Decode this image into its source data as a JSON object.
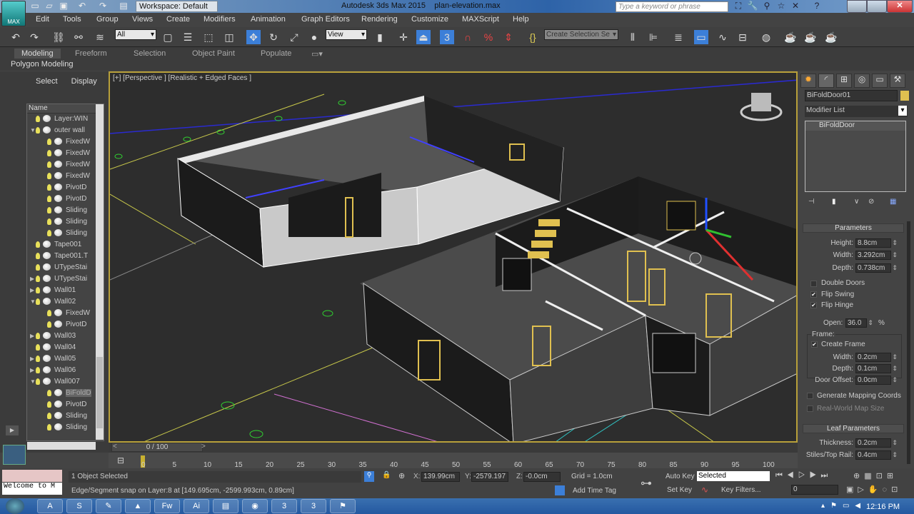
{
  "title_bar": {
    "app_button_label": "MAX",
    "workspace": "Workspace: Default",
    "app_title": "Autodesk 3ds Max  2015",
    "file_name": "plan-elevation.max",
    "search_placeholder": "Type a keyword or phrase"
  },
  "menu": [
    "Edit",
    "Tools",
    "Group",
    "Views",
    "Create",
    "Modifiers",
    "Animation",
    "Graph Editors",
    "Rendering",
    "Customize",
    "MAXScript",
    "Help"
  ],
  "toolbar": {
    "selection_filter": "All",
    "reference_coord": "View",
    "named_selection_placeholder": "Create Selection Se",
    "angle_snap_label": "3"
  },
  "ribbon": {
    "tabs": [
      "Modeling",
      "Freeform",
      "Selection",
      "Object Paint",
      "Populate"
    ],
    "active_tab": "Modeling",
    "panel_label": "Polygon Modeling"
  },
  "scene_explorer": {
    "tabs": [
      "Select",
      "Display"
    ],
    "column_header": "Name",
    "items": [
      {
        "name": "Layer:WIN",
        "level": 0,
        "expand": "",
        "type": "layer"
      },
      {
        "name": "outer wall",
        "level": 0,
        "expand": "open"
      },
      {
        "name": "FixedW",
        "level": 1,
        "expand": ""
      },
      {
        "name": "FixedW",
        "level": 1,
        "expand": ""
      },
      {
        "name": "FixedW",
        "level": 1,
        "expand": ""
      },
      {
        "name": "FixedW",
        "level": 1,
        "expand": ""
      },
      {
        "name": "PivotD",
        "level": 1,
        "expand": ""
      },
      {
        "name": "PivotD",
        "level": 1,
        "expand": ""
      },
      {
        "name": "Sliding",
        "level": 1,
        "expand": ""
      },
      {
        "name": "Sliding",
        "level": 1,
        "expand": ""
      },
      {
        "name": "Sliding",
        "level": 1,
        "expand": ""
      },
      {
        "name": "Tape001",
        "level": 0,
        "expand": "",
        "type": "tape"
      },
      {
        "name": "Tape001.T",
        "level": 0,
        "expand": ""
      },
      {
        "name": "UTypeStai",
        "level": 0,
        "expand": ""
      },
      {
        "name": "UTypeStai",
        "level": 0,
        "expand": "closed"
      },
      {
        "name": "Wall01",
        "level": 0,
        "expand": "closed"
      },
      {
        "name": "Wall02",
        "level": 0,
        "expand": "open"
      },
      {
        "name": "FixedW",
        "level": 1,
        "expand": ""
      },
      {
        "name": "PivotD",
        "level": 1,
        "expand": ""
      },
      {
        "name": "Wall03",
        "level": 0,
        "expand": "closed"
      },
      {
        "name": "Wall04",
        "level": 0,
        "expand": ""
      },
      {
        "name": "Wall05",
        "level": 0,
        "expand": "closed"
      },
      {
        "name": "Wall06",
        "level": 0,
        "expand": "closed"
      },
      {
        "name": "Wall007",
        "level": 0,
        "expand": "open"
      },
      {
        "name": "BiFoldD",
        "level": 1,
        "expand": "",
        "selected": true
      },
      {
        "name": "PivotD",
        "level": 1,
        "expand": ""
      },
      {
        "name": "Sliding",
        "level": 1,
        "expand": ""
      },
      {
        "name": "Sliding",
        "level": 1,
        "expand": ""
      }
    ]
  },
  "viewport": {
    "label": "[+] [Perspective ] [Realistic + Edged Faces ]"
  },
  "command_panel": {
    "object_name": "BiFoldDoor01",
    "object_color": "#e0c050",
    "modifier_list": "Modifier List",
    "stack": [
      "BiFoldDoor"
    ],
    "parameters": {
      "title": "Parameters",
      "height_label": "Height:",
      "height": "8.8cm",
      "width_label": "Width:",
      "width": "3.292cm",
      "depth_label": "Depth:",
      "depth": "0.738cm",
      "double_doors_label": "Double Doors",
      "double_doors": false,
      "flip_swing_label": "Flip Swing",
      "flip_swing": true,
      "flip_hinge_label": "Flip Hinge",
      "flip_hinge": true,
      "open_label": "Open:",
      "open": "36.0",
      "open_unit": "%",
      "frame_group": "Frame:",
      "create_frame_label": "Create Frame",
      "create_frame": true,
      "frame_width_label": "Width:",
      "frame_width": "0.2cm",
      "frame_depth_label": "Depth:",
      "frame_depth": "0.1cm",
      "door_offset_label": "Door Offset:",
      "door_offset": "0.0cm",
      "gen_mapping_label": "Generate Mapping Coords",
      "gen_mapping": false,
      "real_world_label": "Real-World Map Size",
      "real_world": false
    },
    "leaf_parameters": {
      "title": "Leaf Parameters",
      "thickness_label": "Thickness:",
      "thickness": "0.2cm",
      "stiles_label": "Stiles/Top Rail:",
      "stiles": "0.4cm"
    }
  },
  "timeline": {
    "slider": "0 / 100",
    "ticks": [
      "0",
      "5",
      "10",
      "15",
      "20",
      "25",
      "30",
      "35",
      "40",
      "45",
      "50",
      "55",
      "60",
      "65",
      "70",
      "75",
      "80",
      "85",
      "90",
      "95",
      "100"
    ]
  },
  "status": {
    "listener_text": "Welcome to M",
    "selection": "1 Object Selected",
    "snap_info": "Edge/Segment snap on Layer:8 at [149.695cm, -2599.993cm, 0.89cm]",
    "x": "139.99cm",
    "y": "-2579.197",
    "z": "-0.0cm",
    "grid": "Grid = 1.0cm",
    "add_time_tag": "Add Time Tag",
    "auto_key": "Auto Key",
    "set_key": "Set Key",
    "key_mode": "Selected",
    "key_filters": "Key Filters...",
    "frame": "0"
  },
  "taskbar": {
    "apps": [
      "acrobat",
      "skype",
      "paint",
      "vlc",
      "fireworks",
      "illustrator",
      "explorer",
      "chrome",
      "3dsmax",
      "3dsmax",
      "tool"
    ],
    "clock": "12:16 PM"
  }
}
